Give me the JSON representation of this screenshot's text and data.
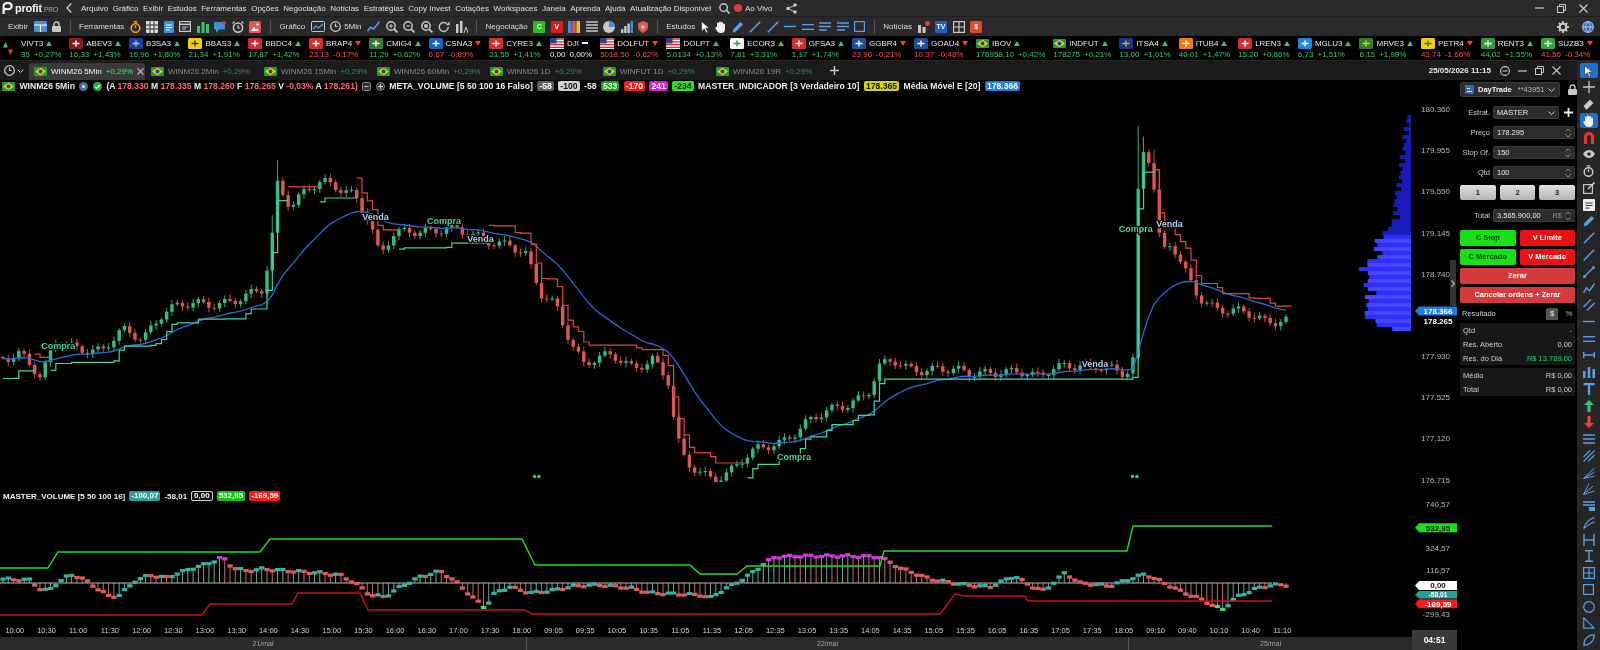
{
  "app": {
    "logo": "profit",
    "logo_suffix": "PRO",
    "live": {
      "label": "Ao Vivo",
      "on": true
    }
  },
  "menu": [
    "Arquivo",
    "Gráfico",
    "Exibir",
    "Estudos",
    "Ferramentas",
    "Opções",
    "Negociação",
    "Notícias",
    "Estratégias",
    "Copy Invest",
    "Cotações",
    "Workspaces",
    "Janela",
    "Aprenda",
    "Ajuda",
    "Atualização Disponível"
  ],
  "toolbar": [
    {
      "label": "Exibir"
    },
    {
      "label": "Ferramentas"
    },
    {
      "label": "Gráfico",
      "period": "5Min"
    },
    {
      "label": "Negociação",
      "buttons": [
        {
          "label": "C",
          "kind": "buy"
        },
        {
          "label": "V",
          "kind": "sell"
        }
      ]
    },
    {
      "label": "Estudos"
    },
    {
      "label": "Notícias",
      "tiles": [
        "TV",
        "$"
      ]
    }
  ],
  "tickers": [
    {
      "symbol": "VIVT3",
      "kind": "up",
      "price": "35",
      "change": "+0,27%"
    },
    {
      "symbol": "ABEV3",
      "kind": "up",
      "price": "16,33",
      "change": "+1,43%"
    },
    {
      "symbol": "B3SA3",
      "kind": "up",
      "price": "16,96",
      "change": "+1,80%"
    },
    {
      "symbol": "BBAS3",
      "kind": "up",
      "price": "21,34",
      "change": "+1,91%"
    },
    {
      "symbol": "BBDC4",
      "kind": "up",
      "price": "17,87",
      "change": "+1,42%"
    },
    {
      "symbol": "BRAP4",
      "kind": "down",
      "price": "23,13",
      "change": "-0,17%"
    },
    {
      "symbol": "CMIG4",
      "kind": "up",
      "price": "11,29",
      "change": "+0,62%"
    },
    {
      "symbol": "CSNA3",
      "kind": "down",
      "price": "6,67",
      "change": "-0,89%"
    },
    {
      "symbol": "CYRE3",
      "kind": "up",
      "price": "21,55",
      "change": "+1,41%"
    },
    {
      "symbol": "DJI",
      "kind": "flat",
      "price": "0,00",
      "change": "0,00%"
    },
    {
      "symbol": "DOLFUT",
      "kind": "down",
      "price": "5018,50",
      "change": "-0,62%"
    },
    {
      "symbol": "DOLPT",
      "kind": "up",
      "price": "5,0134",
      "change": "+0,13%"
    },
    {
      "symbol": "ECOR3",
      "kind": "up",
      "price": "7,81",
      "change": "+3,31%"
    },
    {
      "symbol": "GFSA3",
      "kind": "up",
      "price": "1,17",
      "change": "+1,74%"
    },
    {
      "symbol": "GGBR4",
      "kind": "down",
      "price": "23,96",
      "change": "-0,21%"
    },
    {
      "symbol": "GOAU4",
      "kind": "down",
      "price": "10,37",
      "change": "-0,48%"
    },
    {
      "symbol": "IBOV",
      "kind": "up",
      "price": "176958,10",
      "change": "+0,42%"
    },
    {
      "symbol": "INDFUT",
      "kind": "up",
      "price": "178275",
      "change": "+0,21%"
    },
    {
      "symbol": "ITSA4",
      "kind": "up",
      "price": "13,00",
      "change": "+1,01%"
    },
    {
      "symbol": "ITUB4",
      "kind": "up",
      "price": "40,01",
      "change": "+1,47%"
    },
    {
      "symbol": "LREN3",
      "kind": "up",
      "price": "15,20",
      "change": "+0,86%"
    },
    {
      "symbol": "MGLU3",
      "kind": "up",
      "price": "6,73",
      "change": "+1,51%"
    },
    {
      "symbol": "MRVE3",
      "kind": "up",
      "price": "6,15",
      "change": "+1,99%"
    },
    {
      "symbol": "PETR4",
      "kind": "down",
      "price": "43,74",
      "change": "-1,66%"
    },
    {
      "symbol": "RENT3",
      "kind": "up",
      "price": "44,02",
      "change": "+1,55%"
    },
    {
      "symbol": "SUZB3",
      "kind": "down",
      "price": "41,56",
      "change": "-0,34%"
    }
  ],
  "chart_tabs": [
    {
      "label": "WINM26 5Min",
      "change": "+0,29%",
      "selected": true
    },
    {
      "label": "WINM26 2Min",
      "change": "+0,29%",
      "selected": false
    },
    {
      "label": "WINM26 15Min",
      "change": "+0,29%",
      "selected": false
    },
    {
      "label": "WINM26 60Min",
      "change": "+0,29%",
      "selected": false
    },
    {
      "label": "WINM26 1D",
      "change": "+0,29%",
      "selected": false
    },
    {
      "label": "WINFUT 1D",
      "change": "+0,29%",
      "selected": false
    },
    {
      "label": "WINM26 19R",
      "change": "+0,29%",
      "selected": false
    }
  ],
  "datetime": "25/05/2026 11:15",
  "legend": {
    "symbol": "WINM26 5Min",
    "quote": [
      {
        "key": "(A",
        "value": "178.330"
      },
      {
        "key": "M",
        "value": "178.335"
      },
      {
        "key": "M",
        "value": "178.260"
      },
      {
        "key": "F",
        "value": "178.265"
      },
      {
        "key": "V",
        "value": "-0,03%"
      },
      {
        "key": "A",
        "value": "178.261)"
      }
    ],
    "studies": [
      {
        "name": "META_VOLUME [5 50 100 16 Falso]",
        "values": [
          {
            "text": "-58",
            "color": "#5c5c5c"
          },
          {
            "text": "-100",
            "color": "#d0d0d0"
          },
          {
            "text": "-58"
          },
          {
            "text": "533",
            "color": "#17a317"
          },
          {
            "text": "-170",
            "color": "#ff1a1a"
          },
          {
            "text": "241",
            "color": "#d21fd2"
          },
          {
            "text": "-234",
            "color": "#22e622"
          }
        ]
      },
      {
        "name": "MASTER_INDICADOR [3 Verdadeiro 10]",
        "values": [
          {
            "text": "178.365",
            "color": "#d4d400"
          }
        ]
      },
      {
        "name": "Média Móvel E [20]",
        "values": [
          {
            "text": "178.366",
            "color": "#1e7fe0"
          }
        ]
      }
    ]
  },
  "signals": [
    {
      "label": "Compra",
      "kind": "buy"
    },
    {
      "label": "Venda",
      "kind": "sell"
    },
    {
      "label": "Compra",
      "kind": "buy"
    },
    {
      "label": "Venda",
      "kind": "sell"
    },
    {
      "label": "Compra",
      "kind": "buy"
    },
    {
      "label": "Venda",
      "kind": "sell"
    },
    {
      "label": "Compra",
      "kind": "buy"
    },
    {
      "label": "Venda",
      "kind": "sell"
    }
  ],
  "price_axis": {
    "ticks": [
      "180.360",
      "179.955",
      "179.550",
      "179.145",
      "178.740",
      "177.930",
      "177.525",
      "177.120",
      "176.715"
    ],
    "markers": [
      {
        "text": "178.366",
        "color": "#1e7fe0"
      },
      {
        "text": "178.265"
      }
    ]
  },
  "lower_pane": {
    "title": "MASTER_VOLUME [5 50 100 16]",
    "values": [
      {
        "text": "-100,07",
        "color": "#2aa198"
      },
      {
        "text": "-58,01"
      },
      {
        "text": "0,00",
        "color": "#111111"
      },
      {
        "text": "532,95",
        "color": "#16c116"
      },
      {
        "text": "-169,59",
        "color": "#ff1a1a"
      }
    ],
    "axis_ticks": [
      "740,57",
      "324,57",
      "116,57",
      "-299,43"
    ],
    "markers": [
      {
        "text": "532,95",
        "color": "#16e016"
      },
      {
        "text": "0,00",
        "color": "#ffffff"
      },
      {
        "text": "-58,01",
        "color": "#2aa198"
      },
      {
        "text": "-169,59",
        "color": "#ff1a1a"
      }
    ]
  },
  "time_axis": [
    "10:00",
    "10:30",
    "11:00",
    "11:30",
    "12:00",
    "12:30",
    "13:00",
    "13:30",
    "14:00",
    "14:30",
    "15:00",
    "15:30",
    "16:00",
    "16:30",
    "17:00",
    "17:30",
    "18:00",
    "09:05",
    "09:35",
    "10:05",
    "10:35",
    "11:05",
    "11:35",
    "12:05",
    "12:35",
    "13:05",
    "13:35",
    "14:05",
    "14:35",
    "15:05",
    "15:35",
    "16:05",
    "16:35",
    "17:05",
    "17:35",
    "18:05",
    "09:10",
    "09:40",
    "10:10",
    "10:40",
    "11:10"
  ],
  "date_axis": [
    "21/mai",
    "22/mai",
    "25/mai"
  ],
  "countdown": "04:51",
  "order_panel": {
    "account": "DayTrade",
    "account_id": "**43951",
    "strategy_label": "Estrat.",
    "strategy": "MASTER",
    "fields": [
      {
        "label": "Preço",
        "value": "178.295"
      },
      {
        "label": "Stop Of.",
        "value": "150"
      },
      {
        "label": "Qtd",
        "value": "100"
      }
    ],
    "quantity_presets": [
      "1",
      "2",
      "3"
    ],
    "total_label": "Total",
    "total": "3.565.900,00",
    "currency": "R$",
    "actions": [
      {
        "label": "C Stop",
        "kind": "buy"
      },
      {
        "label": "V Limite",
        "kind": "sell"
      },
      {
        "label": "C Mercado",
        "kind": "buy"
      },
      {
        "label": "V Mercado",
        "kind": "sell"
      },
      {
        "label": "Zerar",
        "kind": "flatten"
      },
      {
        "label": "Cancelar ordens + Zerar",
        "kind": "flatten"
      }
    ],
    "result_label": "Resultado",
    "result_modes": [
      {
        "label": "$",
        "selected": true
      },
      {
        "label": "%",
        "selected": false
      }
    ],
    "summary": [
      [
        {
          "label": "Qtd",
          "value": "-"
        },
        {
          "label": "Res. Aberto",
          "value": "0,00"
        },
        {
          "label": "Res. do Dia",
          "value": "R$ 13.789,00",
          "kind": "positive"
        }
      ],
      [
        {
          "label": "Médio",
          "value": "R$ 0,00"
        },
        {
          "label": "Total",
          "value": "R$ 0,00"
        }
      ]
    ]
  },
  "drawing_tools": [
    {
      "selected": true
    },
    {
      "selected": false
    },
    {
      "selected": false
    },
    {
      "selected": true
    },
    {
      "selected": false
    },
    {
      "selected": false
    },
    {
      "selected": false
    },
    {
      "selected": false
    },
    {
      "selected": false
    },
    {
      "selected": false
    },
    {
      "selected": false
    },
    {
      "selected": false
    },
    {
      "selected": false
    },
    {
      "selected": false
    },
    {
      "selected": false
    },
    {
      "selected": false
    },
    {
      "selected": false
    },
    {
      "selected": false
    },
    {
      "selected": false
    },
    {
      "selected": false
    },
    {
      "selected": false
    },
    {
      "selected": false
    },
    {
      "selected": false
    },
    {
      "selected": false
    },
    {
      "selected": false
    },
    {
      "selected": false
    },
    {
      "selected": false
    },
    {
      "selected": false
    },
    {
      "selected": false
    },
    {
      "selected": false
    },
    {
      "selected": false
    },
    {
      "selected": false
    },
    {
      "selected": false
    },
    {
      "selected": false
    },
    {
      "selected": false
    }
  ]
}
